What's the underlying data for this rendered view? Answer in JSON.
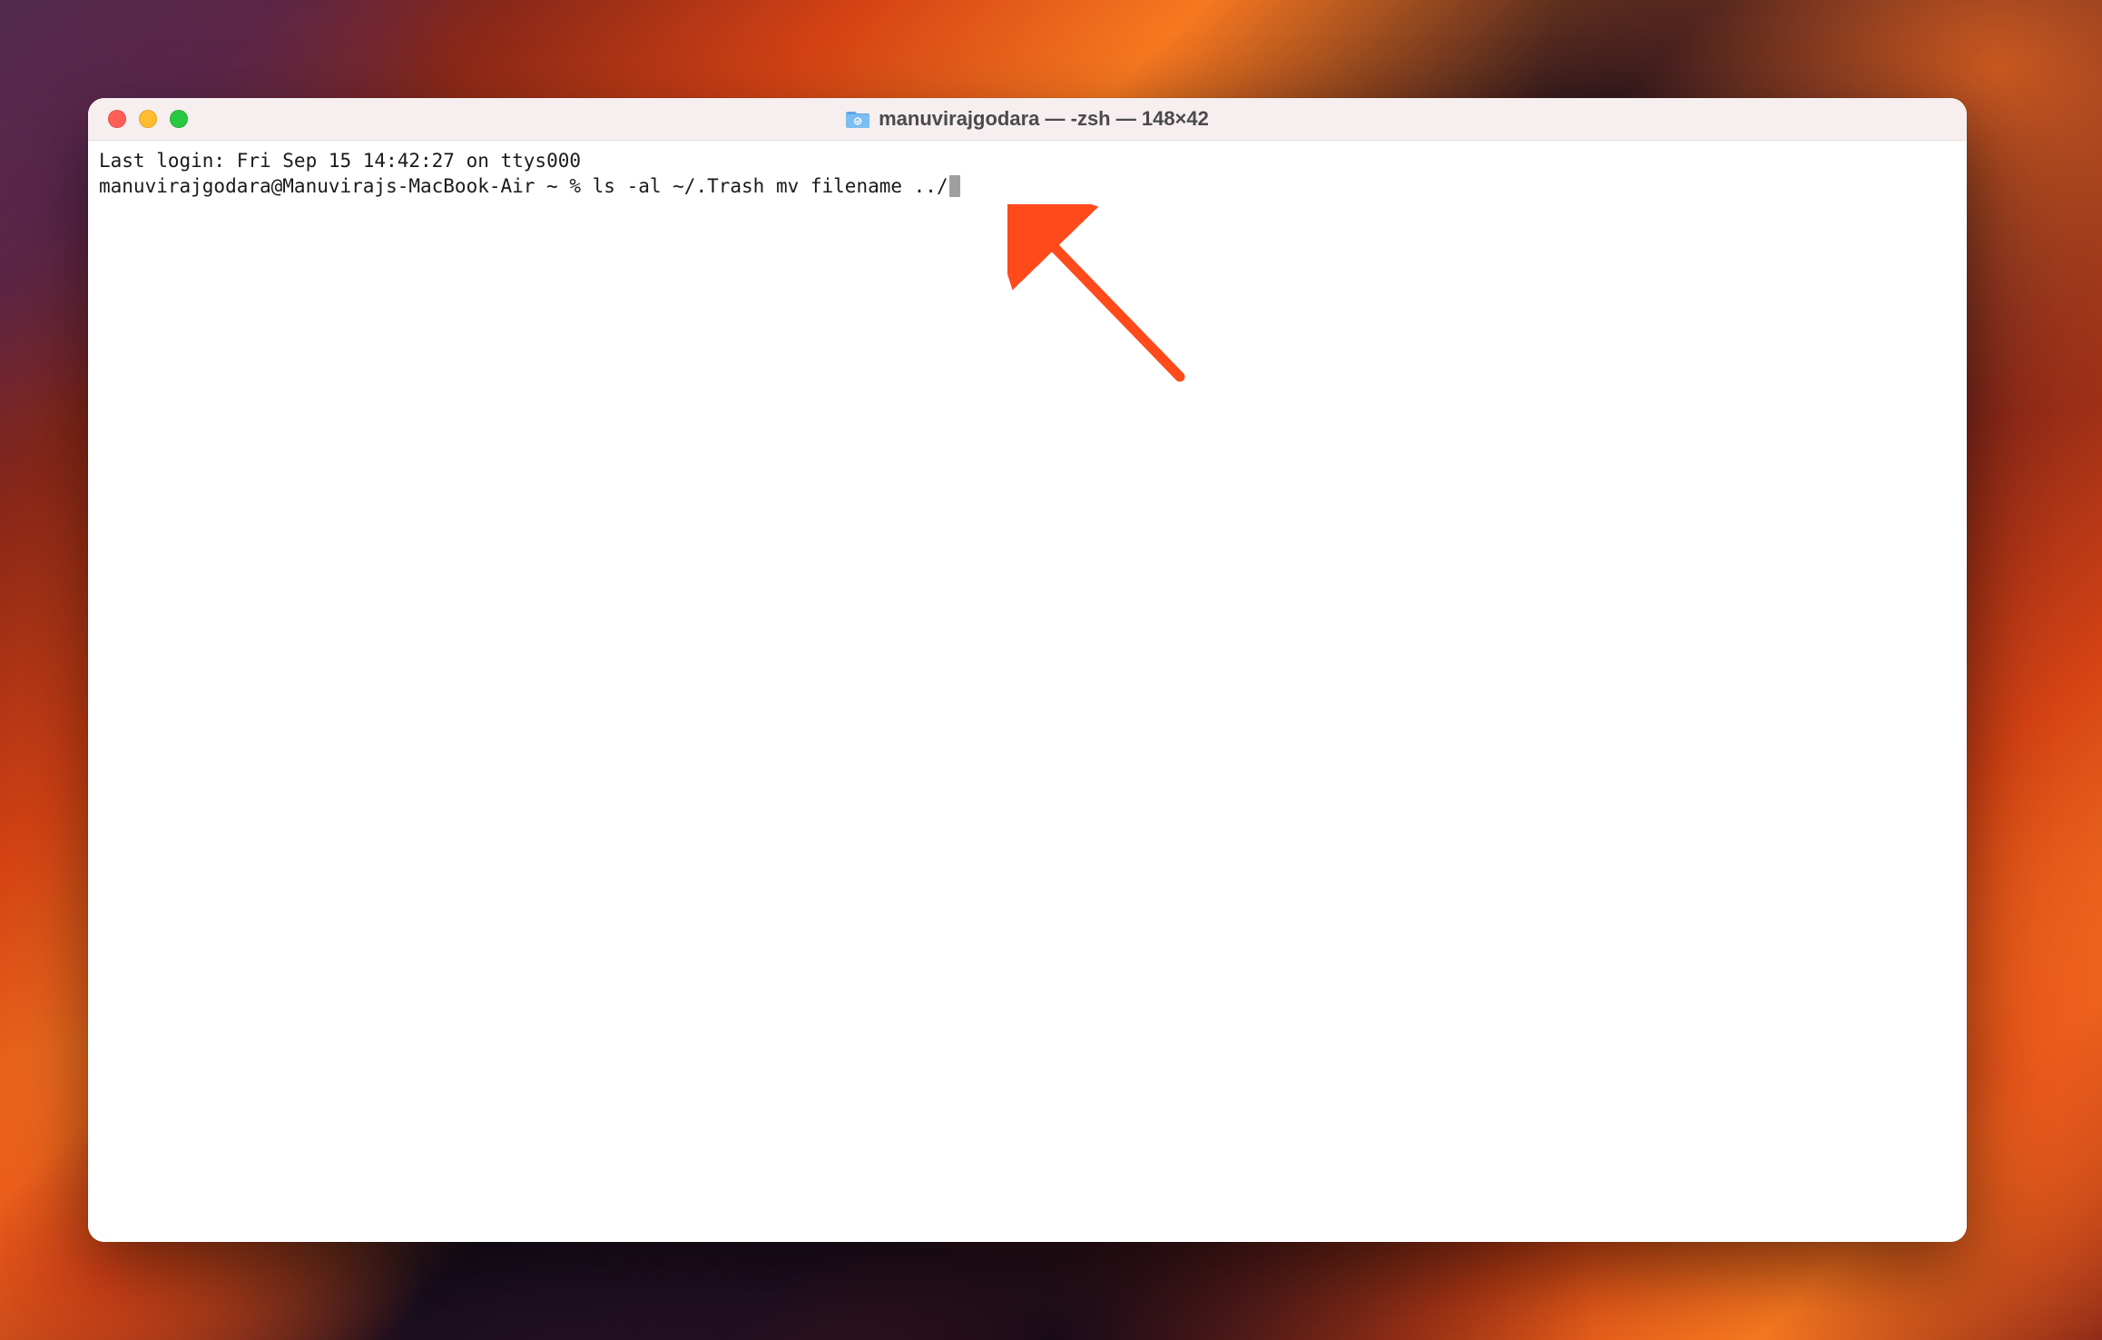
{
  "window": {
    "title": "manuvirajgodara — -zsh — 148×42"
  },
  "terminal": {
    "last_login_line": "Last login: Fri Sep 15 14:42:27 on ttys000",
    "prompt": "manuvirajgodara@Manuvirajs-MacBook-Air ~ % ",
    "command": "ls -al ~/.Trash mv filename ../"
  },
  "colors": {
    "close": "#ff5f57",
    "minimize": "#febc2e",
    "zoom": "#28c840",
    "titlebar_bg": "#f6eeef",
    "arrow": "#ff4a1c"
  }
}
